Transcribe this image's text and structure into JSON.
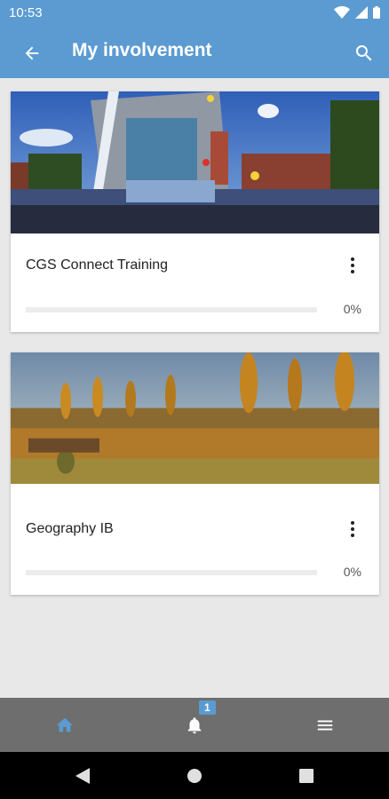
{
  "status": {
    "time": "10:53"
  },
  "appbar": {
    "title": "My involvement"
  },
  "courses": [
    {
      "title": "CGS Connect Training",
      "progress_label": "0%",
      "progress": 0
    },
    {
      "title": "Geography IB",
      "progress_label": "0%",
      "progress": 0
    }
  ],
  "bottom_nav": {
    "notifications_badge": "1"
  },
  "colors": {
    "primary": "#5b9bd1",
    "bottom_nav_bg": "#6e6e6e",
    "active_icon": "#5b9bd1"
  }
}
